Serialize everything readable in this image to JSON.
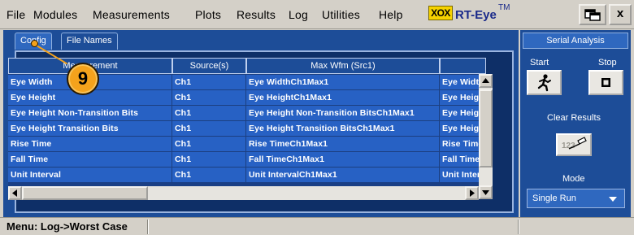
{
  "menu": [
    "File",
    "Modules",
    "Measurements",
    "Plots",
    "Results",
    "Log",
    "Utilities",
    "Help"
  ],
  "logo": {
    "badge": "XOX",
    "name": "RT-Eye",
    "trademark": "TM"
  },
  "window_buttons": {
    "minimize_icon": "window-switch-icon",
    "close_label": "x"
  },
  "tabs": [
    "Config",
    "File Names"
  ],
  "table": {
    "headers": [
      "Measurement",
      "Source(s)",
      "Max Wfm (Src1)",
      ""
    ],
    "rows": [
      [
        "Eye Width",
        "Ch1",
        "Eye WidthCh1Max1",
        "Eye WidthC"
      ],
      [
        "Eye Height",
        "Ch1",
        "Eye HeightCh1Max1",
        "Eye HeightC"
      ],
      [
        "Eye Height Non-Transition Bits",
        "Ch1",
        "Eye Height Non-Transition BitsCh1Max1",
        "Eye Height"
      ],
      [
        "Eye Height Transition Bits",
        "Ch1",
        "Eye Height Transition BitsCh1Max1",
        "Eye Height"
      ],
      [
        "Rise Time",
        "Ch1",
        "Rise TimeCh1Max1",
        "Rise TimeC"
      ],
      [
        "Fall Time",
        "Ch1",
        "Fall TimeCh1Max1",
        "Fall TimeC"
      ],
      [
        "Unit Interval",
        "Ch1",
        "Unit IntervalCh1Max1",
        "Unit Interval"
      ]
    ]
  },
  "step_badge": "9",
  "right_panel": {
    "title": "Serial Analysis",
    "start_label": "Start",
    "stop_label": "Stop",
    "clear_label": "Clear Results",
    "mode_label": "Mode",
    "mode_value": "Single Run"
  },
  "status": {
    "text": "Menu: Log->Worst Case"
  },
  "colors": {
    "panel": "#1d4d98",
    "row": "#2761c4",
    "badge": "#f4a21c",
    "chrome": "#d4d0c8"
  }
}
